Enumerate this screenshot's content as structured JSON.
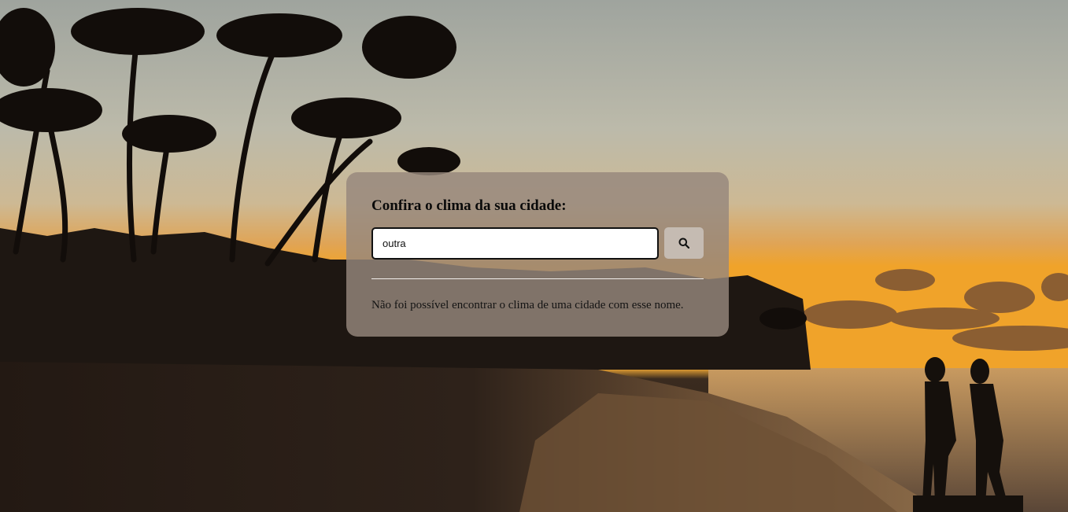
{
  "search": {
    "title": "Confira o clima da sua cidade:",
    "input_value": "outra",
    "button_icon": "search-icon"
  },
  "result": {
    "message": "Não foi possível encontrar o clima de uma cidade com esse nome."
  },
  "theme": {
    "card_background": "#96887c",
    "button_background": "#c5bbb2"
  }
}
